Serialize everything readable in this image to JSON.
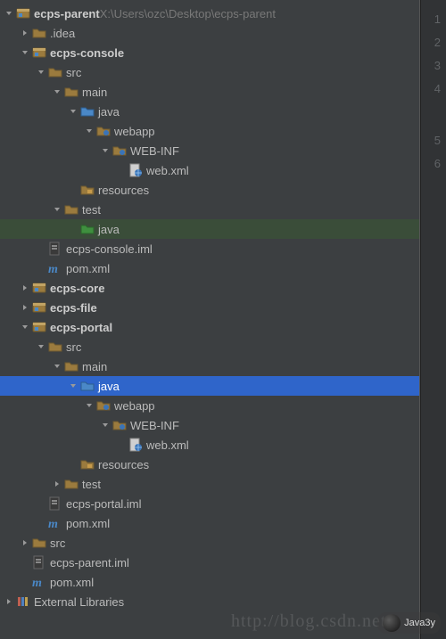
{
  "root": {
    "name": "ecps-parent",
    "path": "X:\\Users\\ozc\\Desktop\\ecps-parent"
  },
  "tree": [
    {
      "d": 0,
      "exp": "open",
      "icon": "module",
      "label": "ecps-parent",
      "bold": true,
      "suffix_dim": "X:\\Users\\ozc\\Desktop\\ecps-parent"
    },
    {
      "d": 1,
      "exp": "closed",
      "icon": "folder",
      "label": ".idea"
    },
    {
      "d": 1,
      "exp": "open",
      "icon": "module",
      "label": "ecps-console",
      "bold": true
    },
    {
      "d": 2,
      "exp": "open",
      "icon": "folder",
      "label": "src"
    },
    {
      "d": 3,
      "exp": "open",
      "icon": "folder",
      "label": "main"
    },
    {
      "d": 4,
      "exp": "open",
      "icon": "src-folder",
      "label": "java"
    },
    {
      "d": 5,
      "exp": "open",
      "icon": "web-folder",
      "label": "webapp"
    },
    {
      "d": 6,
      "exp": "open",
      "icon": "web-folder",
      "label": "WEB-INF"
    },
    {
      "d": 7,
      "exp": "none",
      "icon": "xml-web",
      "label": "web.xml"
    },
    {
      "d": 4,
      "exp": "none",
      "icon": "res-folder",
      "label": "resources"
    },
    {
      "d": 3,
      "exp": "open",
      "icon": "folder",
      "label": "test"
    },
    {
      "d": 4,
      "exp": "none",
      "icon": "test-folder",
      "label": "java",
      "sel": "green"
    },
    {
      "d": 2,
      "exp": "none",
      "icon": "iml",
      "label": "ecps-console.iml"
    },
    {
      "d": 2,
      "exp": "none",
      "icon": "maven",
      "label": "pom.xml"
    },
    {
      "d": 1,
      "exp": "closed",
      "icon": "module",
      "label": "ecps-core",
      "bold": true
    },
    {
      "d": 1,
      "exp": "closed",
      "icon": "module",
      "label": "ecps-file",
      "bold": true
    },
    {
      "d": 1,
      "exp": "open",
      "icon": "module",
      "label": "ecps-portal",
      "bold": true
    },
    {
      "d": 2,
      "exp": "open",
      "icon": "folder",
      "label": "src"
    },
    {
      "d": 3,
      "exp": "open",
      "icon": "folder",
      "label": "main"
    },
    {
      "d": 4,
      "exp": "open",
      "icon": "src-folder",
      "label": "java",
      "sel": "blue"
    },
    {
      "d": 5,
      "exp": "open",
      "icon": "web-folder",
      "label": "webapp"
    },
    {
      "d": 6,
      "exp": "open",
      "icon": "web-folder",
      "label": "WEB-INF"
    },
    {
      "d": 7,
      "exp": "none",
      "icon": "xml-web",
      "label": "web.xml"
    },
    {
      "d": 4,
      "exp": "none",
      "icon": "res-folder",
      "label": "resources"
    },
    {
      "d": 3,
      "exp": "closed",
      "icon": "folder",
      "label": "test"
    },
    {
      "d": 2,
      "exp": "none",
      "icon": "iml",
      "label": "ecps-portal.iml"
    },
    {
      "d": 2,
      "exp": "none",
      "icon": "maven",
      "label": "pom.xml"
    },
    {
      "d": 1,
      "exp": "closed",
      "icon": "folder",
      "label": "src"
    },
    {
      "d": 1,
      "exp": "none",
      "icon": "iml",
      "label": "ecps-parent.iml"
    },
    {
      "d": 1,
      "exp": "none",
      "icon": "maven",
      "label": "pom.xml"
    },
    {
      "d": 0,
      "exp": "closed",
      "icon": "libs",
      "label": "External Libraries"
    }
  ],
  "line_numbers": [
    "1",
    "2",
    "3",
    "4",
    "",
    "5",
    "6"
  ],
  "watermark": "http://blog.csdn.net/",
  "brand": "Java3y"
}
